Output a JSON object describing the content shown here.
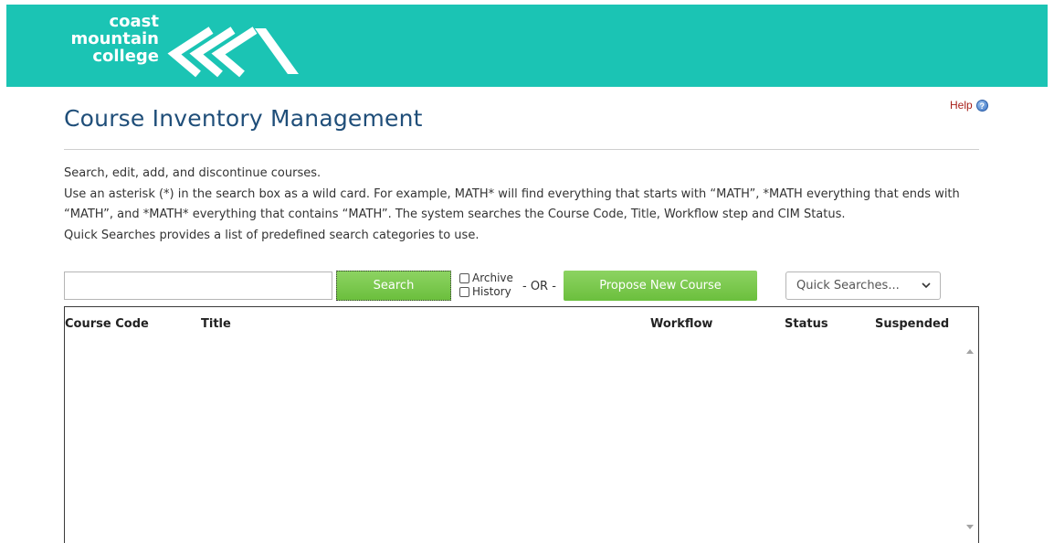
{
  "header": {
    "logo_lines": [
      "coast",
      "mountain",
      "college"
    ],
    "brand_color": "#1bc4b4"
  },
  "page": {
    "title": "Course Inventory Management",
    "help_label": "Help",
    "help_icon": "help-icon",
    "title_color": "#1f4e79"
  },
  "intro": {
    "line1": "Search, edit, add, and discontinue courses.",
    "line2": "Use an asterisk (*) in the search box as a wild card. For example, MATH* will find everything that starts with “MATH”, *MATH everything that ends with “MATH”, and *MATH* everything that contains “MATH”. The system searches the Course Code, Title, Workflow step and CIM Status.",
    "line3": "Quick Searches provides a list of predefined search categories to use."
  },
  "search": {
    "input_value": "",
    "input_placeholder": "",
    "search_button": "Search",
    "archive_label": "Archive",
    "history_label": "History",
    "or_label": "- OR -",
    "propose_button": "Propose New Course",
    "quick_searches": "Quick Searches...",
    "button_color": "#6bbf3d"
  },
  "table": {
    "columns": [
      "Course Code",
      "Title",
      "Workflow",
      "Status",
      "Suspended"
    ],
    "rows": []
  }
}
